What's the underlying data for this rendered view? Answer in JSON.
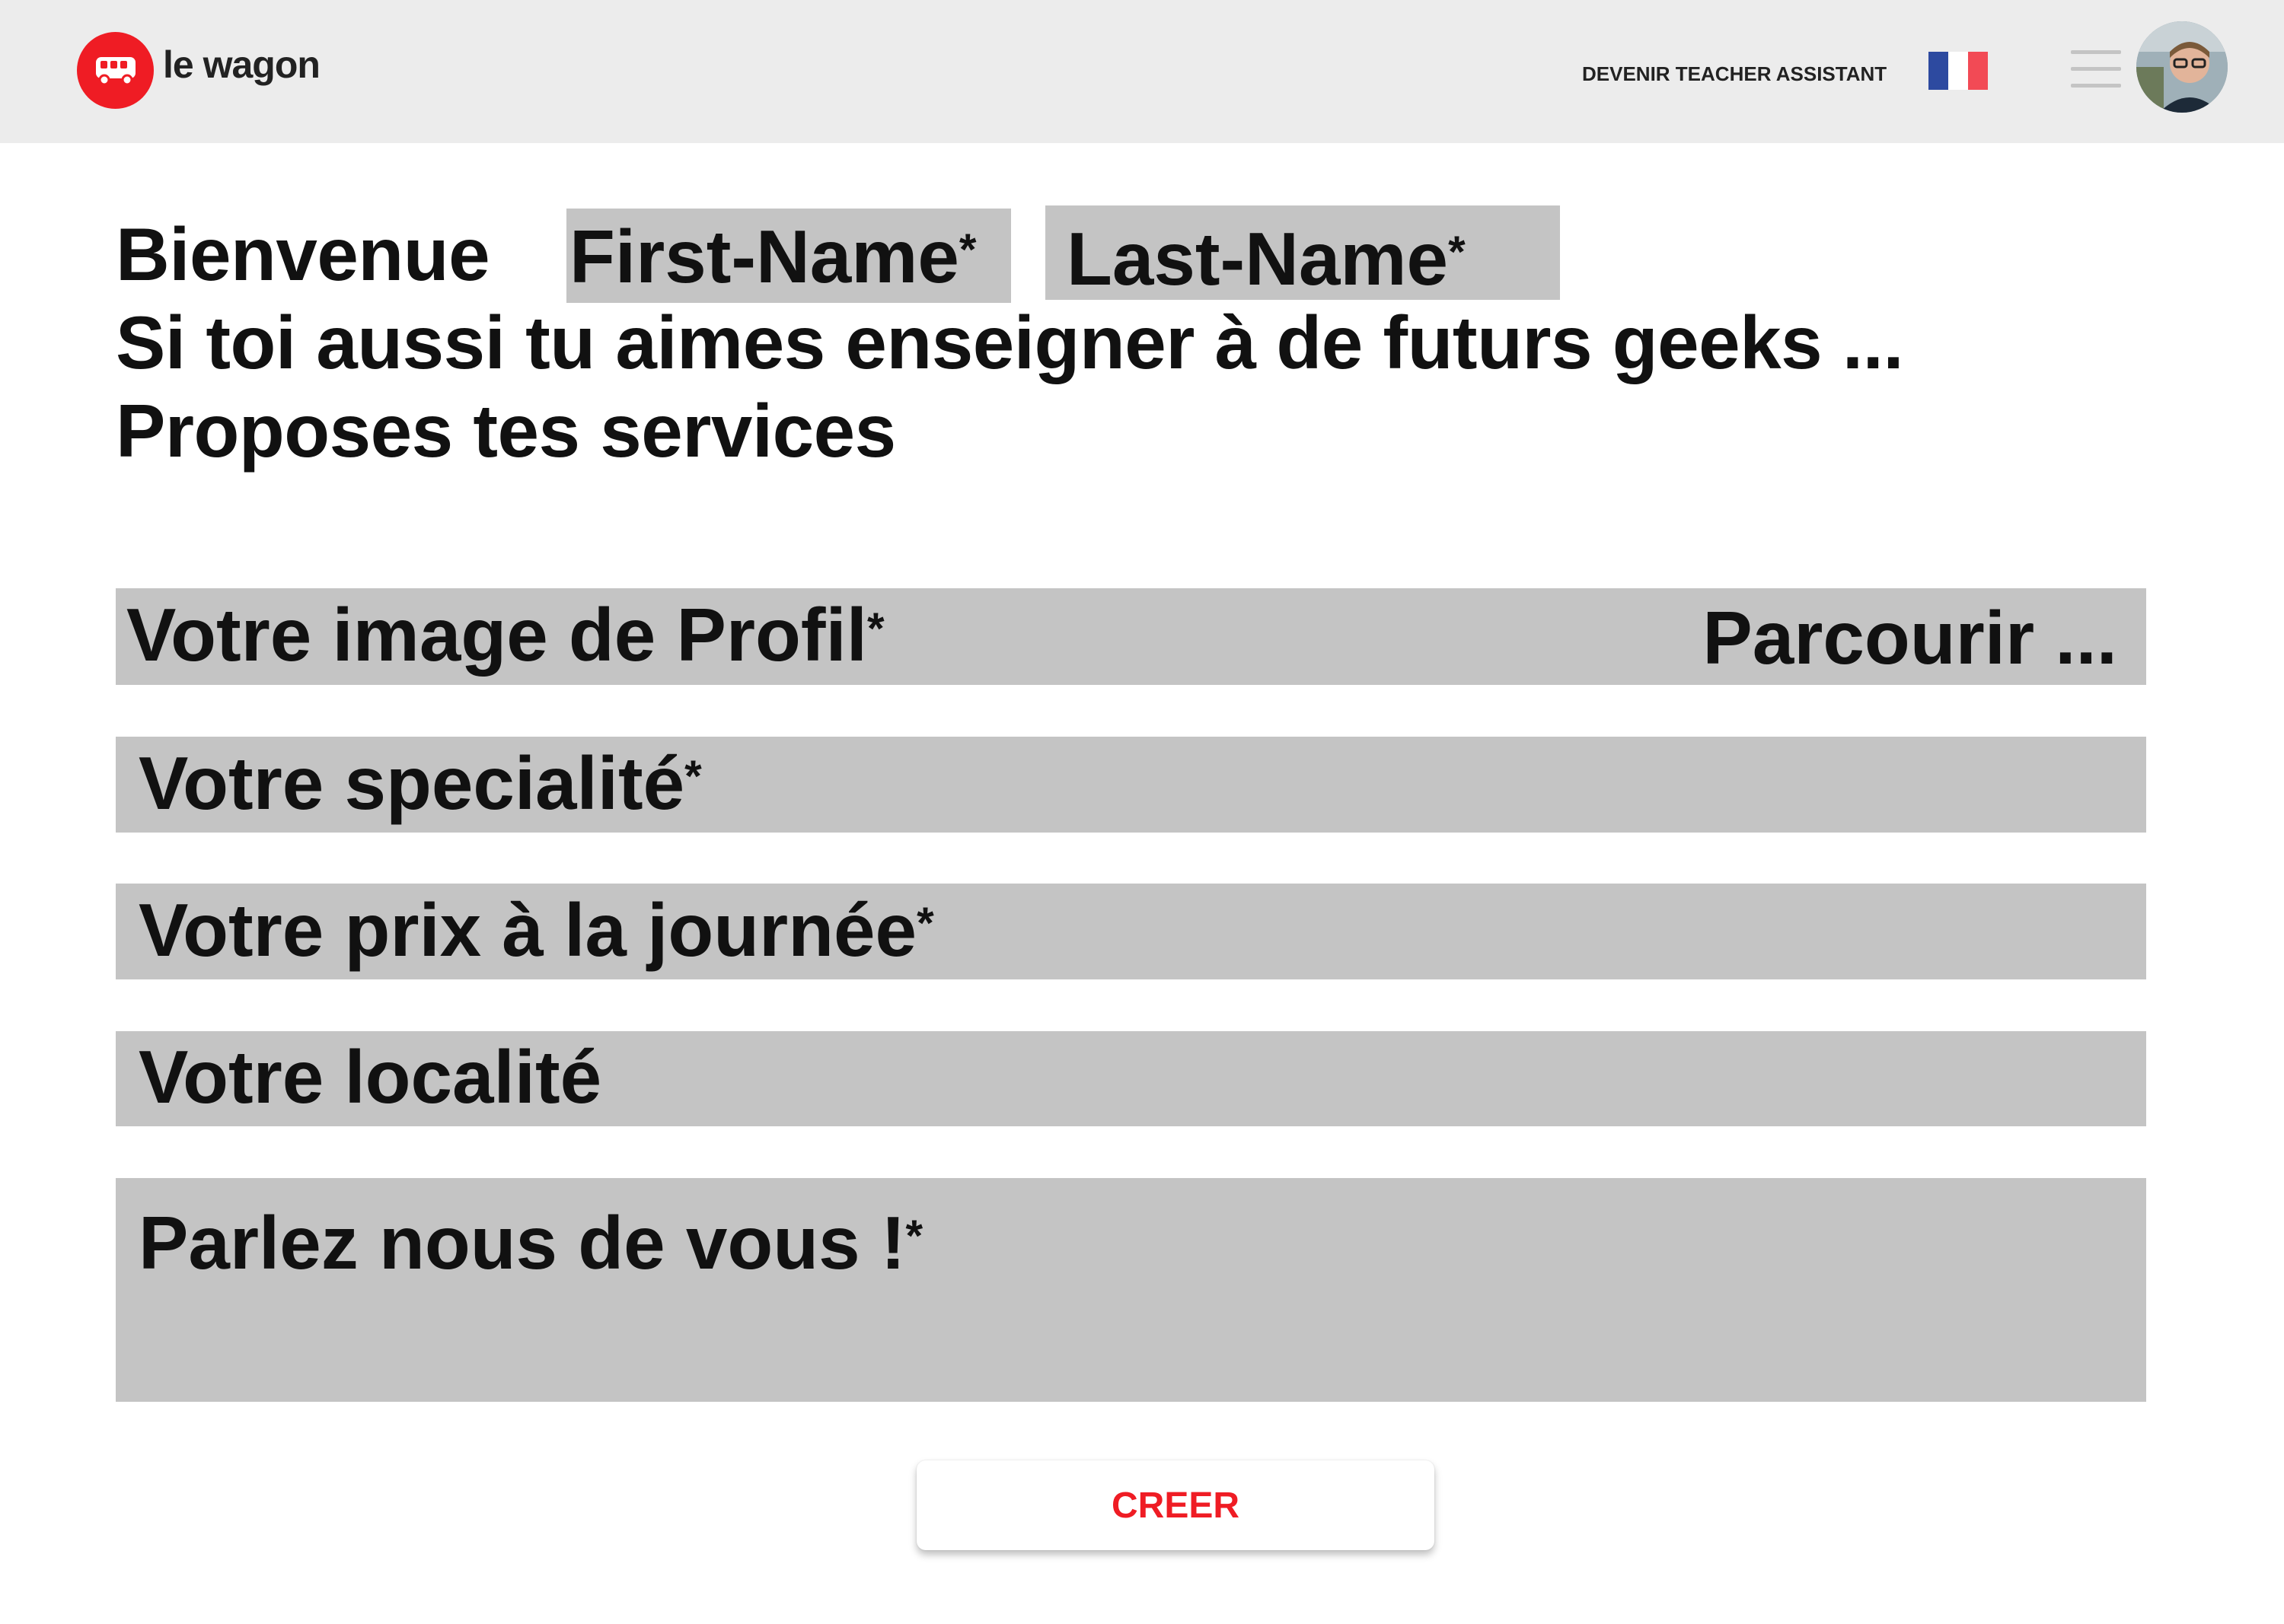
{
  "brand": {
    "name": "le wagon",
    "color": "#ef1c24"
  },
  "nav": {
    "link": "DEVENIR TEACHER ASSISTANT",
    "flag_colors": [
      "#2d4aa0",
      "#ffffff",
      "#f24a55"
    ],
    "menu_icon": "hamburger-icon",
    "avatar_icon": "user-avatar"
  },
  "welcome": {
    "greeting": "Bienvenue",
    "first_name": "First-Name",
    "last_name": "Last-Name",
    "required_mark": "*",
    "line2": "Si toi aussi tu aimes enseigner à de futurs geeks ...",
    "line3": "Proposes tes services"
  },
  "form": {
    "profile_image": {
      "label": "Votre image de Profil",
      "required": "*",
      "browse": "Parcourir ..."
    },
    "speciality": {
      "label": "Votre specialité",
      "required": "*"
    },
    "daily_price": {
      "label": "Votre prix à la journée",
      "required": "*"
    },
    "locality": {
      "label": "Votre localité"
    },
    "about": {
      "label": "Parlez nous de vous !",
      "required": "*"
    },
    "submit_label": "CREER"
  },
  "colors": {
    "field_bg": "#c4c4c4",
    "navbar_bg": "#ececec",
    "accent": "#ef1c24"
  }
}
